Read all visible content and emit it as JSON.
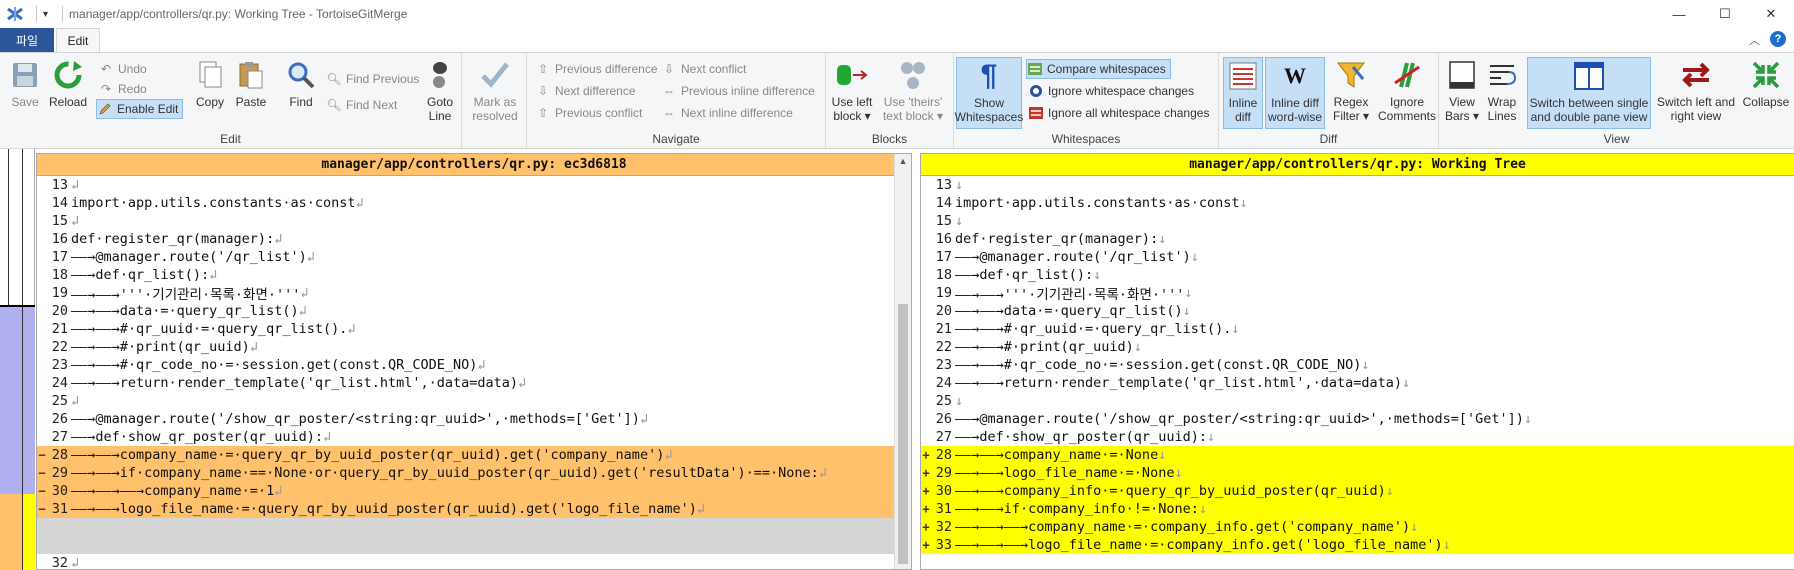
{
  "window": {
    "title": "manager/app/controllers/qr.py: Working Tree - TortoiseGitMerge",
    "qa_arrow": "▾",
    "controls": {
      "minimize": "—",
      "maximize": "☐",
      "close": "✕"
    }
  },
  "tabs": {
    "file_label": "파일",
    "edit_label": "Edit",
    "collapse_glyph": "︿",
    "help_glyph": "?"
  },
  "ribbon": {
    "edit_group": {
      "label": "Edit",
      "save": "Save",
      "reload": "Reload",
      "undo": "Undo",
      "redo": "Redo",
      "enable_edit": "Enable Edit",
      "copy": "Copy",
      "paste": "Paste",
      "find": "Find",
      "find_previous": "Find Previous",
      "find_next": "Find Next",
      "goto_line_1": "Goto",
      "goto_line_2": "Line",
      "mark_resolved_1": "Mark as",
      "mark_resolved_2": "resolved"
    },
    "navigate_group": {
      "label": "Navigate",
      "prev_diff": "Previous difference",
      "next_diff": "Next difference",
      "prev_conflict": "Previous conflict",
      "next_conflict": "Next conflict",
      "prev_inline": "Previous inline difference",
      "next_inline": "Next inline difference"
    },
    "blocks_group": {
      "label": "Blocks",
      "use_left_1": "Use left",
      "use_left_2": "block ▾",
      "use_theirs_1": "Use 'theirs'",
      "use_theirs_2": "text block ▾"
    },
    "whitespaces_group": {
      "label": "Whitespaces",
      "show_ws_1": "Show",
      "show_ws_2": "Whitespaces",
      "compare_ws": "Compare whitespaces",
      "ignore_ws_changes": "Ignore whitespace changes",
      "ignore_all_ws": "Ignore all whitespace changes"
    },
    "diff_group": {
      "label": "Diff",
      "inline_diff_1": "Inline",
      "inline_diff_2": "diff",
      "inline_word_1": "Inline diff",
      "inline_word_2": "word-wise",
      "regex_1": "Regex",
      "regex_2": "Filter ▾",
      "ignore_comments_1": "Ignore",
      "ignore_comments_2": "Comments"
    },
    "view_group": {
      "label": "View",
      "view_bars_1": "View",
      "view_bars_2": "Bars ▾",
      "wrap_1": "Wrap",
      "wrap_2": "Lines",
      "switch_pane_1": "Switch between single",
      "switch_pane_2": "and double pane view",
      "switch_lr_1": "Switch left and",
      "switch_lr_2": "right view",
      "collapse": "Collapse"
    }
  },
  "colors": {
    "left_header": "#ffc16b",
    "right_header": "#ffff00",
    "removed": "#ffc16b",
    "added": "#ffff00",
    "empty": "#d6d6d6"
  },
  "left_pane": {
    "header": "manager/app/controllers/qr.py: ec3d6818",
    "lines": [
      {
        "n": "13",
        "m": "",
        "t": "",
        "ws": "↲",
        "s": ""
      },
      {
        "n": "14",
        "m": "",
        "t": "import·app.utils.constants·as·const",
        "ws": "↲",
        "s": ""
      },
      {
        "n": "15",
        "m": "",
        "t": "",
        "ws": "↲",
        "s": ""
      },
      {
        "n": "16",
        "m": "",
        "t": "def·register_qr(manager):",
        "ws": "↲",
        "s": ""
      },
      {
        "n": "17",
        "m": "",
        "t": "——→@manager.route('/qr_list')",
        "ws": "↲",
        "s": ""
      },
      {
        "n": "18",
        "m": "",
        "t": "——→def·qr_list():",
        "ws": "↲",
        "s": ""
      },
      {
        "n": "19",
        "m": "",
        "t": "——→——→'''·기기관리·목록·화면·'''",
        "ws": "↲",
        "s": ""
      },
      {
        "n": "20",
        "m": "",
        "t": "——→——→data·=·query_qr_list()",
        "ws": "↲",
        "s": ""
      },
      {
        "n": "21",
        "m": "",
        "t": "——→——→#·qr_uuid·=·query_qr_list().",
        "ws": "↲",
        "s": ""
      },
      {
        "n": "22",
        "m": "",
        "t": "——→——→#·print(qr_uuid)",
        "ws": "↲",
        "s": ""
      },
      {
        "n": "23",
        "m": "",
        "t": "——→——→#·qr_code_no·=·session.get(const.QR_CODE_NO)",
        "ws": "↲",
        "s": ""
      },
      {
        "n": "24",
        "m": "",
        "t": "——→——→return·render_template('qr_list.html',·data=data)",
        "ws": "↲",
        "s": ""
      },
      {
        "n": "25",
        "m": "",
        "t": "",
        "ws": "↲",
        "s": ""
      },
      {
        "n": "26",
        "m": "",
        "t": "——→@manager.route('/show_qr_poster/<string:qr_uuid>',·methods=['Get'])",
        "ws": "↲",
        "s": ""
      },
      {
        "n": "27",
        "m": "",
        "t": "——→def·show_qr_poster(qr_uuid):",
        "ws": "↲",
        "s": ""
      },
      {
        "n": "28",
        "m": "−",
        "t": "——→——→company_name·=·query_qr_by_uuid_poster(qr_uuid).get('company_name')",
        "ws": "↲",
        "s": "removed"
      },
      {
        "n": "29",
        "m": "−",
        "t": "——→——→if·company_name·==·None·or·query_qr_by_uuid_poster(qr_uuid).get('resultData')·==·None:",
        "ws": "↲",
        "s": "removed"
      },
      {
        "n": "30",
        "m": "−",
        "t": "——→——→——→company_name·=·1",
        "ws": "↲",
        "s": "removed"
      },
      {
        "n": "31",
        "m": "−",
        "t": "——→——→logo_file_name·=·query_qr_by_uuid_poster(qr_uuid).get('logo_file_name')",
        "ws": "↲",
        "s": "removed"
      },
      {
        "n": "",
        "m": "",
        "t": "",
        "ws": "",
        "s": "empty-block"
      },
      {
        "n": "",
        "m": "",
        "t": "",
        "ws": "",
        "s": "empty-block"
      },
      {
        "n": "32",
        "m": "",
        "t": "",
        "ws": "↲",
        "s": ""
      }
    ]
  },
  "right_pane": {
    "header": "manager/app/controllers/qr.py: Working Tree",
    "lines": [
      {
        "n": "13",
        "m": "",
        "t": "",
        "ws": "↓",
        "s": ""
      },
      {
        "n": "14",
        "m": "",
        "t": "import·app.utils.constants·as·const",
        "ws": "↓",
        "s": ""
      },
      {
        "n": "15",
        "m": "",
        "t": "",
        "ws": "↓",
        "s": ""
      },
      {
        "n": "16",
        "m": "",
        "t": "def·register_qr(manager):",
        "ws": "↓",
        "s": ""
      },
      {
        "n": "17",
        "m": "",
        "t": "——→@manager.route('/qr_list')",
        "ws": "↓",
        "s": ""
      },
      {
        "n": "18",
        "m": "",
        "t": "——→def·qr_list():",
        "ws": "↓",
        "s": ""
      },
      {
        "n": "19",
        "m": "",
        "t": "——→——→'''·기기관리·목록·화면·'''",
        "ws": "↓",
        "s": ""
      },
      {
        "n": "20",
        "m": "",
        "t": "——→——→data·=·query_qr_list()",
        "ws": "↓",
        "s": ""
      },
      {
        "n": "21",
        "m": "",
        "t": "——→——→#·qr_uuid·=·query_qr_list().",
        "ws": "↓",
        "s": ""
      },
      {
        "n": "22",
        "m": "",
        "t": "——→——→#·print(qr_uuid)",
        "ws": "↓",
        "s": ""
      },
      {
        "n": "23",
        "m": "",
        "t": "——→——→#·qr_code_no·=·session.get(const.QR_CODE_NO)",
        "ws": "↓",
        "s": ""
      },
      {
        "n": "24",
        "m": "",
        "t": "——→——→return·render_template('qr_list.html',·data=data)",
        "ws": "↓",
        "s": ""
      },
      {
        "n": "25",
        "m": "",
        "t": "",
        "ws": "↓",
        "s": ""
      },
      {
        "n": "26",
        "m": "",
        "t": "——→@manager.route('/show_qr_poster/<string:qr_uuid>',·methods=['Get'])",
        "ws": "↓",
        "s": ""
      },
      {
        "n": "27",
        "m": "",
        "t": "——→def·show_qr_poster(qr_uuid):",
        "ws": "↓",
        "s": ""
      },
      {
        "n": "28",
        "m": "+",
        "t": "——→——→company_name·=·None",
        "ws": "↓",
        "s": "added"
      },
      {
        "n": "29",
        "m": "+",
        "t": "——→——→logo_file_name·=·None",
        "ws": "↓",
        "s": "added"
      },
      {
        "n": "30",
        "m": "+",
        "t": "——→——→company_info·=·query_qr_by_uuid_poster(qr_uuid)",
        "ws": "↓",
        "s": "added"
      },
      {
        "n": "31",
        "m": "+",
        "t": "——→——→if·company_info·!=·None:",
        "ws": "↓",
        "s": "added"
      },
      {
        "n": "32",
        "m": "+",
        "t": "——→——→——→company_name·=·company_info.get('company_name')",
        "ws": "↓",
        "s": "added"
      },
      {
        "n": "33",
        "m": "+",
        "t": "——→——→——→logo_file_name·=·company_info.get('logo_file_name')",
        "ws": "↓",
        "s": "added"
      }
    ]
  }
}
